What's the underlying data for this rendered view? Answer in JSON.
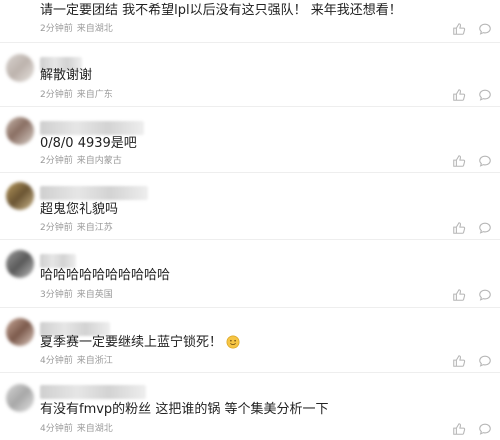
{
  "comments": [
    {
      "text": "请一定要团结 我不希望lpl以后没有这只强队！ 来年我还想看！",
      "time": "2分钟前",
      "location": "来自湖北"
    },
    {
      "text": "解散谢谢",
      "time": "2分钟前",
      "location": "来自广东"
    },
    {
      "text": "0/8/0 4939是吧",
      "time": "2分钟前",
      "location": "来自内蒙古"
    },
    {
      "text": "超鬼您礼貌吗",
      "time": "2分钟前",
      "location": "来自江苏"
    },
    {
      "text": "哈哈哈哈哈哈哈哈哈哈",
      "time": "3分钟前",
      "location": "来自英国"
    },
    {
      "text": "夏季赛一定要继续上蓝宁锁死！",
      "time": "4分钟前",
      "location": "来自浙江"
    },
    {
      "text": "有没有fmvp的粉丝 这把谁的锅 等个集美分析一下",
      "time": "4分钟前",
      "location": "来自湖北"
    }
  ],
  "icons": {
    "like": "thumbs-up-icon",
    "reply": "comment-bubble-icon",
    "emoji": "smiling-face-emoji"
  },
  "colors": {
    "text": "#222222",
    "meta": "#9a9a9a",
    "icon": "#b5b5b5",
    "divider": "#eeeeee"
  }
}
